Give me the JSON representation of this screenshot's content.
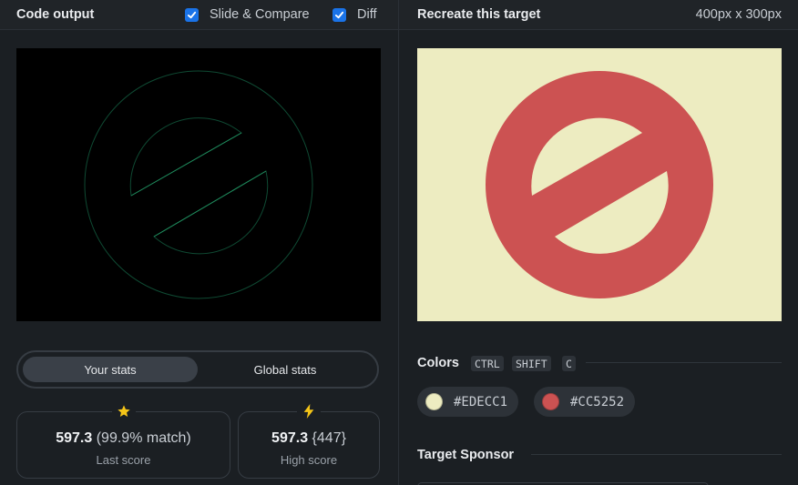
{
  "code_panel": {
    "title": "Code output",
    "slide_compare_label": "Slide & Compare",
    "diff_label": "Diff"
  },
  "target_panel": {
    "title": "Recreate this target",
    "dimensions": "400px x 300px"
  },
  "stats": {
    "tabs": [
      "Your stats",
      "Global stats"
    ],
    "last": {
      "score": "597.3",
      "match": "(99.9% match)",
      "label": "Last score",
      "icon": "star-icon"
    },
    "high": {
      "score": "597.3",
      "count": "{447}",
      "label": "High score",
      "icon": "lightning-icon"
    }
  },
  "colors": {
    "title": "Colors",
    "shortcut_keys": [
      "CTRL",
      "SHIFT",
      "C"
    ],
    "swatches": [
      {
        "hex": "#EDECC1",
        "color": "#EDECC1"
      },
      {
        "hex": "#CC5252",
        "color": "#CC5252"
      }
    ]
  },
  "sponsor": {
    "title": "Target Sponsor"
  },
  "theme": {
    "accent": "#1a73e8",
    "star": "#f5c518",
    "diff_outline": "#1f8a5c"
  }
}
